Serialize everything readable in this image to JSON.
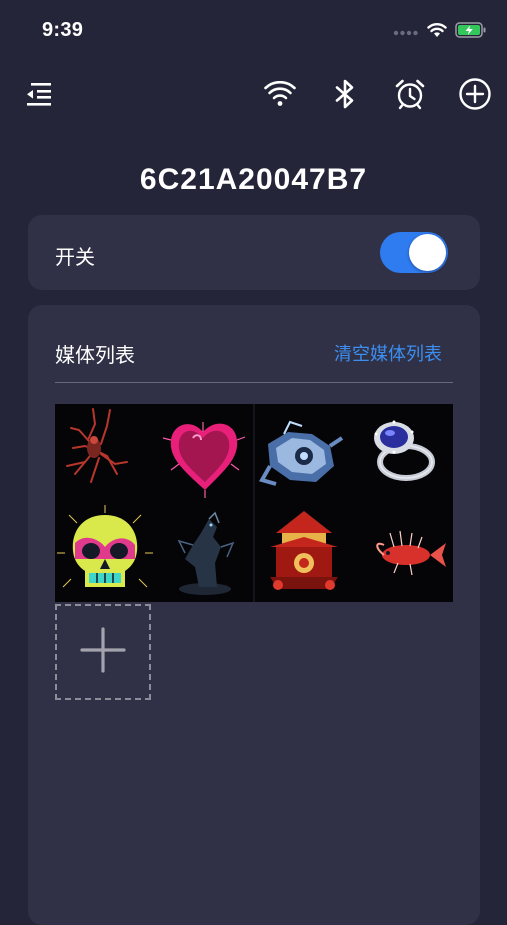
{
  "status": {
    "time": "9:39",
    "icons": [
      "signal-dots-icon",
      "wifi-icon",
      "battery-charging-icon"
    ]
  },
  "nav": {
    "icons": [
      "menu-icon",
      "wifi-icon",
      "bluetooth-icon",
      "alarm-icon",
      "add-circle-icon"
    ]
  },
  "device": {
    "id": "6C21A20047B7"
  },
  "switch_card": {
    "label": "开关",
    "on": true
  },
  "media": {
    "title": "媒体列表",
    "clear_label": "清空媒体列表",
    "items": [
      {
        "name": "red-shrimp"
      },
      {
        "name": "pink-heart"
      },
      {
        "name": "blue-robot"
      },
      {
        "name": "sapphire-ring"
      },
      {
        "name": "neon-skull"
      },
      {
        "name": "dark-dragon"
      },
      {
        "name": "red-pagoda"
      },
      {
        "name": "red-fish"
      }
    ],
    "add_icon": "plus-icon"
  },
  "colors": {
    "background": "#242538",
    "card": "#303146",
    "accent": "#2f7bf0",
    "link": "#3c8ef0"
  }
}
